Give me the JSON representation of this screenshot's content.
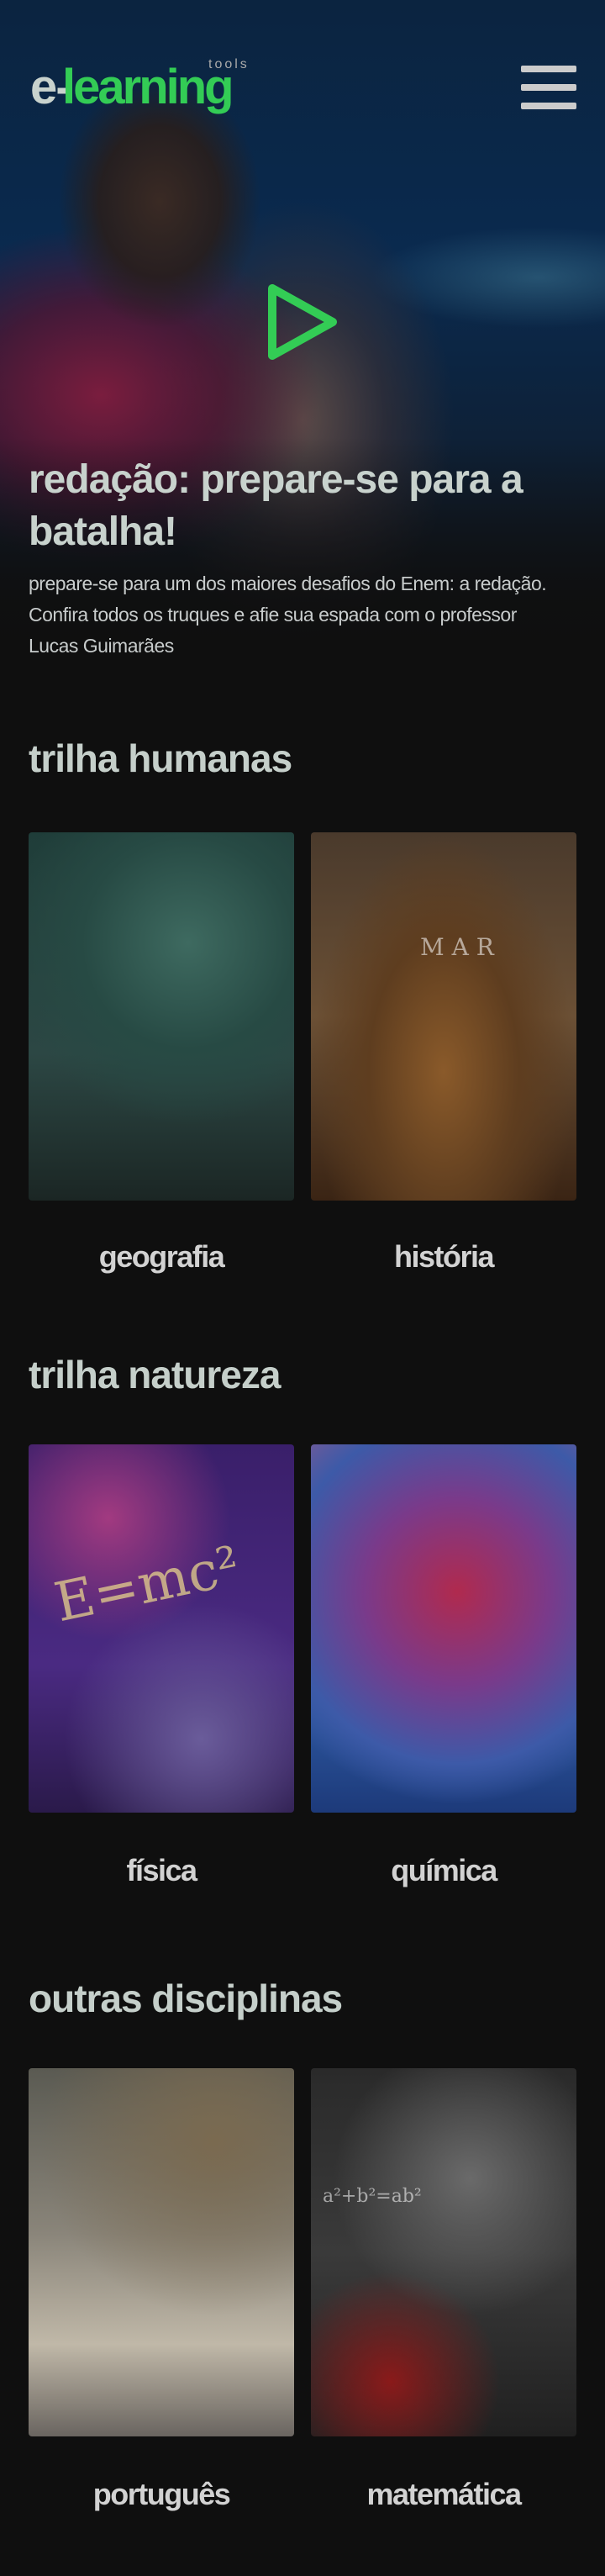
{
  "header": {
    "logo": {
      "prefix": "e-",
      "main": "learning",
      "sub": "tools"
    },
    "menu_icon": "hamburger-icon"
  },
  "hero": {
    "title": "redação: prepare-se para a batalha!",
    "description": "prepare-se para um dos maiores desafios do Enem: a redação. Confira todos os truques e afie sua espada com o professor Lucas Guimarães",
    "play_icon": "play-icon",
    "accent": "#33cc55"
  },
  "sections": [
    {
      "title": "trilha humanas",
      "cards": [
        {
          "label": "geografia"
        },
        {
          "label": "história"
        }
      ]
    },
    {
      "title": "trilha natureza",
      "cards": [
        {
          "label": "física"
        },
        {
          "label": "química"
        }
      ]
    },
    {
      "title": "outras disciplinas",
      "cards": [
        {
          "label": "português"
        },
        {
          "label": "matemática"
        }
      ]
    }
  ]
}
